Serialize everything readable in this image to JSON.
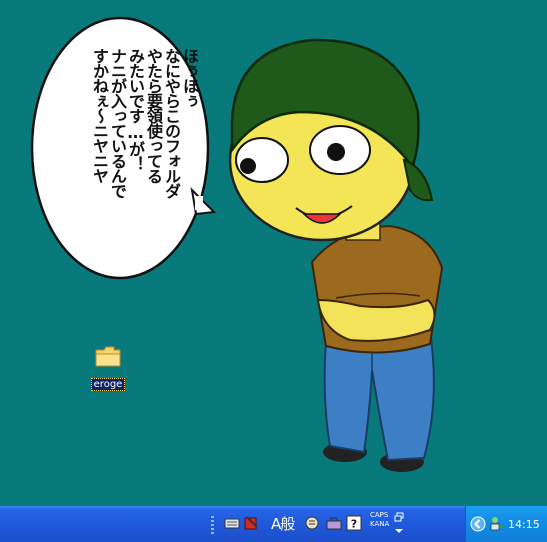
{
  "speech_bubble": {
    "lines": [
      "ほぅほぅ",
      "なにやらこのフォルダ",
      "やたら要領使ってる",
      "みたいです…が！",
      "ナニが入っているんで",
      "すかねぇ～ニヤニヤ"
    ]
  },
  "desktop_icon": {
    "label": "eroge"
  },
  "taskbar": {
    "lang_indicator": "A般",
    "caps_label": "CAPS",
    "kana_label": "KANA",
    "clock": "14:15"
  },
  "colors": {
    "desktop_bg": "#087a7c",
    "taskbar": "#1f57d8",
    "tray": "#138ee6"
  }
}
